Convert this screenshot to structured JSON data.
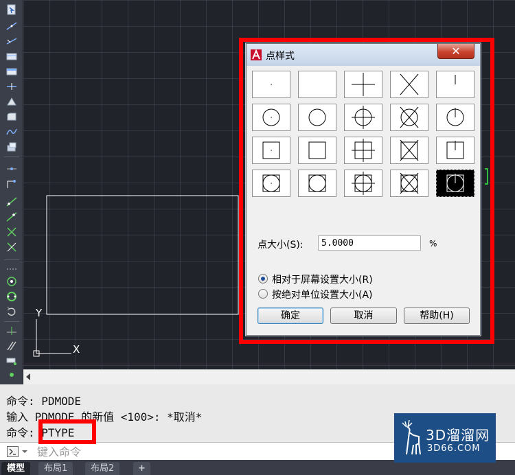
{
  "dialog": {
    "title": "点样式",
    "close_symbol": "✕",
    "selected_style_index": 19,
    "point_size_label": "点大小(S):",
    "point_size_value": "5.0000",
    "percent_symbol": "%",
    "radio_relative_label": "相对于屏幕设置大小(R)",
    "radio_absolute_label": "按绝对单位设置大小(A)",
    "radio_selected": "relative",
    "ok_label": "确定",
    "cancel_label": "取消",
    "help_label": "帮助(H)"
  },
  "command": {
    "lines": [
      "命令: PDMODE",
      "输入 PDMODE 的新值 <100>: *取消*",
      "命令: PTYPE"
    ],
    "input_placeholder": "键入命令"
  },
  "ucs": {
    "x_label": "X",
    "y_label": "Y"
  },
  "layout_tabs": [
    {
      "label": "模型",
      "active": true
    },
    {
      "label": "布局1",
      "active": false
    },
    {
      "label": "布局2",
      "active": false
    },
    {
      "label": "+",
      "active": false
    }
  ],
  "watermark": {
    "brand": "3D溜溜网",
    "domain": "3D66.COM"
  },
  "colors": {
    "highlight": "#ff0000",
    "drawing_bg": "#21232b",
    "grid": "#464a5a"
  },
  "icons": {
    "dialog_app": "autocad-a-icon",
    "close": "close-icon",
    "command_prompt": "command-prompt-icon",
    "watermark": "deer-logo-icon"
  }
}
